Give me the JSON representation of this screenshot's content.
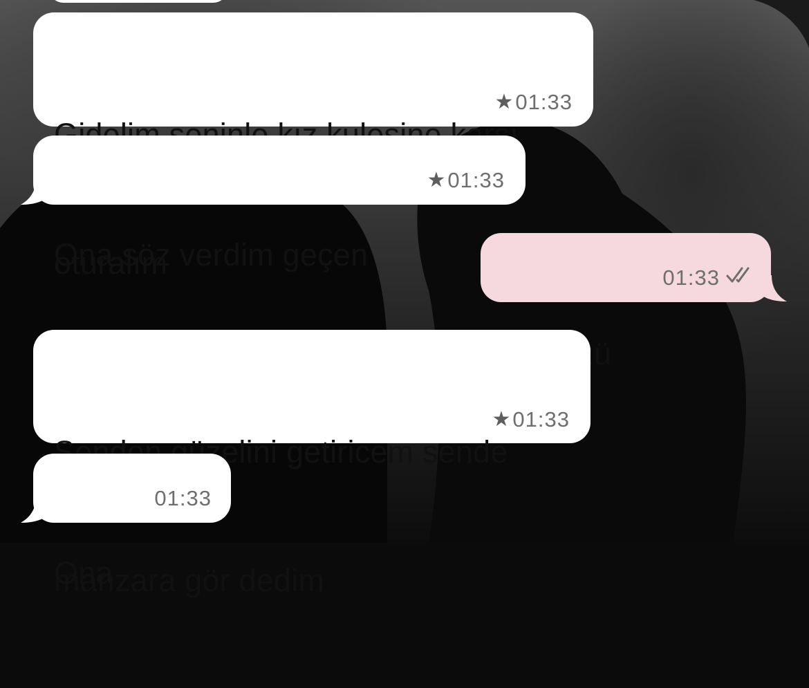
{
  "messages": [
    {
      "id": "msg1",
      "direction": "incoming",
      "lines": [
        "Gidelim seninle kız kulesine karşı",
        "oturalım"
      ],
      "time": "01:33",
      "starred": true
    },
    {
      "id": "msg2",
      "direction": "incoming",
      "lines": [
        "Ona söz verdim geçen"
      ],
      "time": "01:33",
      "starred": true
    },
    {
      "id": "msg3",
      "direction": "outgoing",
      "lines": [
        "ne sözü"
      ],
      "time": "01:33",
      "starred": false,
      "read_receipt": "double-check-icon"
    },
    {
      "id": "msg4",
      "direction": "incoming",
      "lines": [
        "Senden güzelini getiricem sende",
        "manzara gör dedim"
      ],
      "time": "01:33",
      "starred": true
    },
    {
      "id": "msg5",
      "direction": "incoming",
      "lines": [
        "Ona"
      ],
      "time": "01:33",
      "starred": false
    }
  ],
  "icons": {
    "star": "star-icon",
    "read": "double-check-icon"
  },
  "colors": {
    "incoming_bubble": "#ffffff",
    "outgoing_bubble": "#f6d9de",
    "meta_text": "#6e6e6e"
  }
}
